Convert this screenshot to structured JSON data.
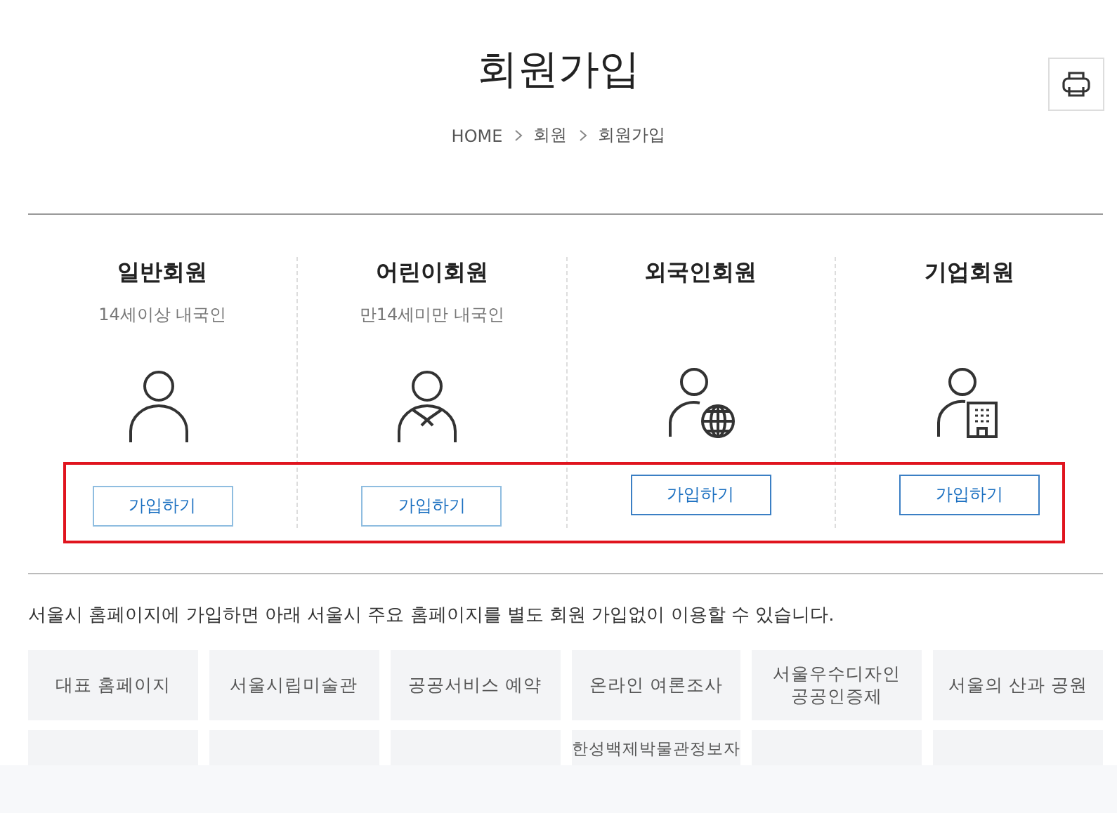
{
  "page": {
    "title": "회원가입"
  },
  "breadcrumb": [
    "HOME",
    "회원",
    "회원가입"
  ],
  "member_types": [
    {
      "title": "일반회원",
      "subtitle": "14세이상 내국인",
      "kind": "person",
      "button": "가입하기",
      "highlighted": false
    },
    {
      "title": "어린이회원",
      "subtitle": "만14세미만 내국인",
      "kind": "child",
      "button": "가입하기",
      "highlighted": false
    },
    {
      "title": "외국인회원",
      "kind": "globe",
      "button": "가입하기",
      "highlighted": true
    },
    {
      "title": "기업회원",
      "kind": "building",
      "button": "가입하기",
      "highlighted": true
    }
  ],
  "intro": "서울시 홈페이지에 가입하면 아래 서울시 주요 홈페이지를 별도 회원 가입없이 이용할 수 있습니다.",
  "sites": [
    {
      "kind": "link",
      "label": "대표 홈페이지"
    },
    {
      "kind": "link",
      "label": "서울시립미술관"
    },
    {
      "kind": "link",
      "label": "공공서비스 예약"
    },
    {
      "kind": "link",
      "label": "온라인 여론조사"
    },
    {
      "kind": "link",
      "label": "서울우수디자인\n공공인증제"
    },
    {
      "kind": "link",
      "label": "서울의 산과 공원"
    },
    {
      "kind": "blank"
    },
    {
      "kind": "blank"
    },
    {
      "kind": "blank"
    },
    {
      "kind": "link",
      "label": "한성백제박물관정보자"
    },
    {
      "kind": "blank"
    },
    {
      "kind": "blank"
    }
  ]
}
